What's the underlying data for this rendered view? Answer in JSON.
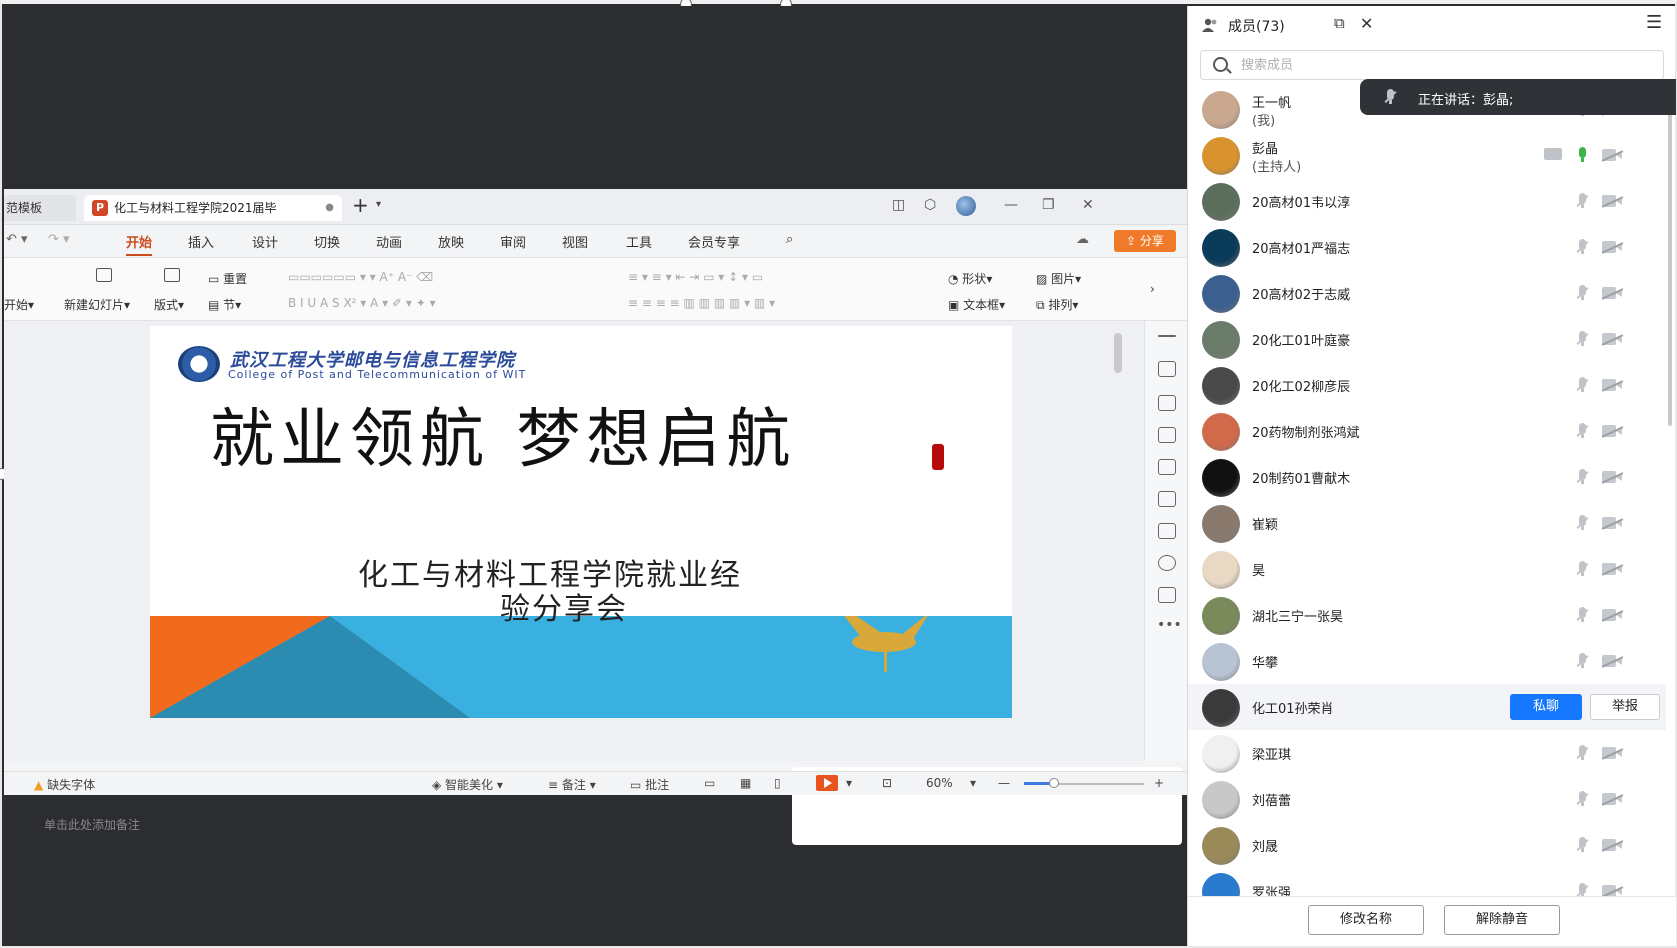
{
  "wps": {
    "tab_left_label": "范模板",
    "doc_tab_title": "化工与材料工程学院2021届毕",
    "ppt_badge": "P",
    "menu": [
      "开始",
      "插入",
      "设计",
      "切换",
      "动画",
      "放映",
      "审阅",
      "视图",
      "工具",
      "会员专享"
    ],
    "share_label": "分享",
    "ribbon": {
      "start_label": "开始",
      "new_slide": "新建幻灯片",
      "layout": "版式",
      "reset": "重置",
      "section": "节",
      "shape": "形状",
      "picture": "图片",
      "textbox": "文本框",
      "arrange": "排列"
    },
    "notes_placeholder": "单击此处添加备注",
    "status": {
      "missing_font": "缺失字体",
      "smart_beautify": "智能美化",
      "notes": "备注",
      "comments": "批注",
      "zoom": "60%",
      "zoom_level": 0.25
    }
  },
  "slide": {
    "logo_cn": "武汉工程大学邮电与信息工程学院",
    "logo_en": "College of Post and Telecommunication of WIT",
    "title": "就业领航  梦想启航",
    "subtitle_line1": "化工与材料工程学院就业经",
    "subtitle_line2": "验分享会",
    "colors": {
      "orange": "#f26b1d",
      "blue": "#3ab0e0",
      "dark_blue": "#2b8bb0"
    }
  },
  "panel": {
    "title": "成员(73)",
    "search_placeholder": "搜索成员",
    "speaking_text": "正在讲话：彭晶;",
    "members": [
      {
        "name": "王一帆",
        "role": "(我)",
        "avatar": "#c9a88f"
      },
      {
        "name": "彭晶",
        "role": "(主持人)",
        "avatar": "#d9932e",
        "host": true
      },
      {
        "name": "20高材01韦以淳",
        "avatar": "#5b6e5c"
      },
      {
        "name": "20高材01严福志",
        "avatar": "#0a3b58"
      },
      {
        "name": "20高材02于志威",
        "avatar": "#3b5f8f"
      },
      {
        "name": "20化工01叶庭豪",
        "avatar": "#6b7b6a"
      },
      {
        "name": "20化工02柳彦辰",
        "avatar": "#4a4a4a"
      },
      {
        "name": "20药物制剂张鸿斌",
        "avatar": "#d06a4a"
      },
      {
        "name": "20制药01曹献木",
        "avatar": "#111111"
      },
      {
        "name": "崔颖",
        "avatar": "#8a7a6e"
      },
      {
        "name": "昊",
        "avatar": "#e8d8c4"
      },
      {
        "name": "湖北三宁一张昊",
        "avatar": "#7a8a5a"
      },
      {
        "name": "华攀",
        "avatar": "#b8c4d4"
      },
      {
        "name": "化工01孙荣肖",
        "avatar": "#3a3a3a",
        "highlight": true
      },
      {
        "name": "梁亚琪",
        "avatar": "#f0f0f0"
      },
      {
        "name": "刘蓓蕾",
        "avatar": "#c8c8c8"
      },
      {
        "name": "刘晟",
        "avatar": "#9a8a5a"
      },
      {
        "name": "罗张强",
        "avatar": "#2a7ad0"
      }
    ],
    "private_chat": "私聊",
    "report": "举报",
    "rename_button": "修改名称",
    "unmute_button": "解除静音"
  }
}
